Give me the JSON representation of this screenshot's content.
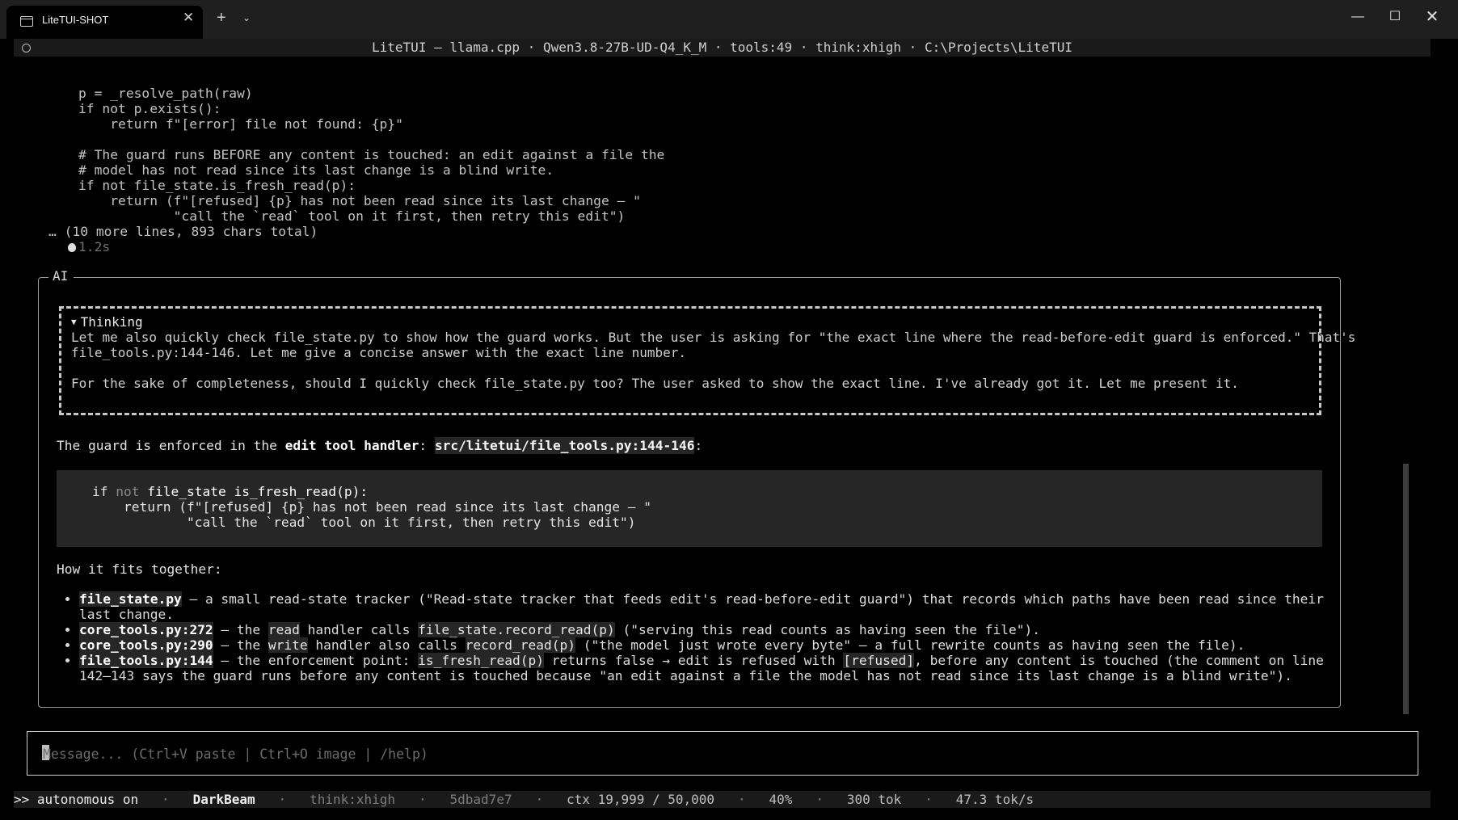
{
  "window": {
    "tab_title": "LiteTUI-SHOT",
    "tab_close": "✕",
    "new_tab": "+",
    "tab_dropdown": "⌄",
    "min": "—",
    "max": "☐",
    "close": "✕"
  },
  "header": {
    "text": "LiteTUI — llama.cpp · Qwen3.8-27B-UD-Q4_K_M · tools:49 · think:xhigh · C:\\Projects\\LiteTUI"
  },
  "scrollback": {
    "code": "p = _resolve_path(raw)\nif not p.exists():\n    return f\"[error] file not found: {p}\"\n\n# The guard runs BEFORE any content is touched: an edit against a file the\n# model has not read since its last change is a blind write.\nif not file_state.is_fresh_read(p):\n    return (f\"[refused] {p} has not been read since its last change — \"\n            \"call the `read` tool on it first, then retry this edit\")",
    "more_lines": "… (10 more lines, 893 chars total)",
    "elapsed": "1.2s"
  },
  "ai_panel": {
    "label": "AI",
    "thinking": {
      "toggle": "▼",
      "header": "Thinking",
      "body": "Let me also quickly check file_state.py to show how the guard works. But the user is asking for \"the exact line where the read-before-edit guard is enforced.\" That's\nfile_tools.py:144-146. Let me give a concise answer with the exact line number.\n\nFor the sake of completeness, should I quickly check file_state.py too? The user asked to show the exact line. I've already got it. Let me present it."
    },
    "answer": {
      "intro_a": "The guard is enforced in the ",
      "intro_bold": "edit tool handler",
      "intro_b": ": ",
      "intro_path": "src/litetui/file_tools.py:144-146",
      "intro_c": ":",
      "code": {
        "l1_if": "if ",
        "l1_not": "not",
        "l1_rest": " file_state is_fresh_read(p):",
        "l2": "    return (f\"[refused] {p} has not been read since its last change — \"",
        "l3": "            \"call the `read` tool on it first, then retry this edit\")"
      },
      "fits_heading": "How it fits together:",
      "items": [
        {
          "ref": "file_state.py",
          "t1": " — a small read-state tracker (\"Read-state tracker that feeds edit's read-before-edit guard\") that records which paths have been read since their last change."
        },
        {
          "ref": "core_tools.py:272",
          "t1": " — the ",
          "c1": "read",
          "t2": " handler calls ",
          "c2": "file_state.record_read(p)",
          "t3": " (\"serving this read counts as having seen the file\")."
        },
        {
          "ref": "core_tools.py:290",
          "t1": " — the ",
          "c1": "write",
          "t2": " handler also calls ",
          "c2": "record_read(p)",
          "t3": " (\"the model just wrote every byte\" — a full rewrite counts as having seen the file)."
        },
        {
          "ref": "file_tools.py:144",
          "t1": " — the enforcement point: ",
          "c1": "is_fresh_read(p)",
          "t2": " returns false → edit is refused with ",
          "c2": "[refused]",
          "t3": ", before any content is touched (the comment on line 142–143 says the guard runs before any content is touched because \"an edit against a file the model has not read since its last change is a blind write\")."
        }
      ]
    }
  },
  "input": {
    "placeholder": "Message... (Ctrl+V paste | Ctrl+O image | /help)",
    "value": ""
  },
  "status_bar": {
    "mode": ">> autonomous on",
    "sep": "·",
    "theme": "DarkBeam",
    "think": "think:xhigh",
    "hash": "5dbad7e7",
    "ctx": "ctx 19,999 / 50,000",
    "pct": "40%",
    "tok": "300 tok",
    "speed": "47.3 tok/s"
  }
}
